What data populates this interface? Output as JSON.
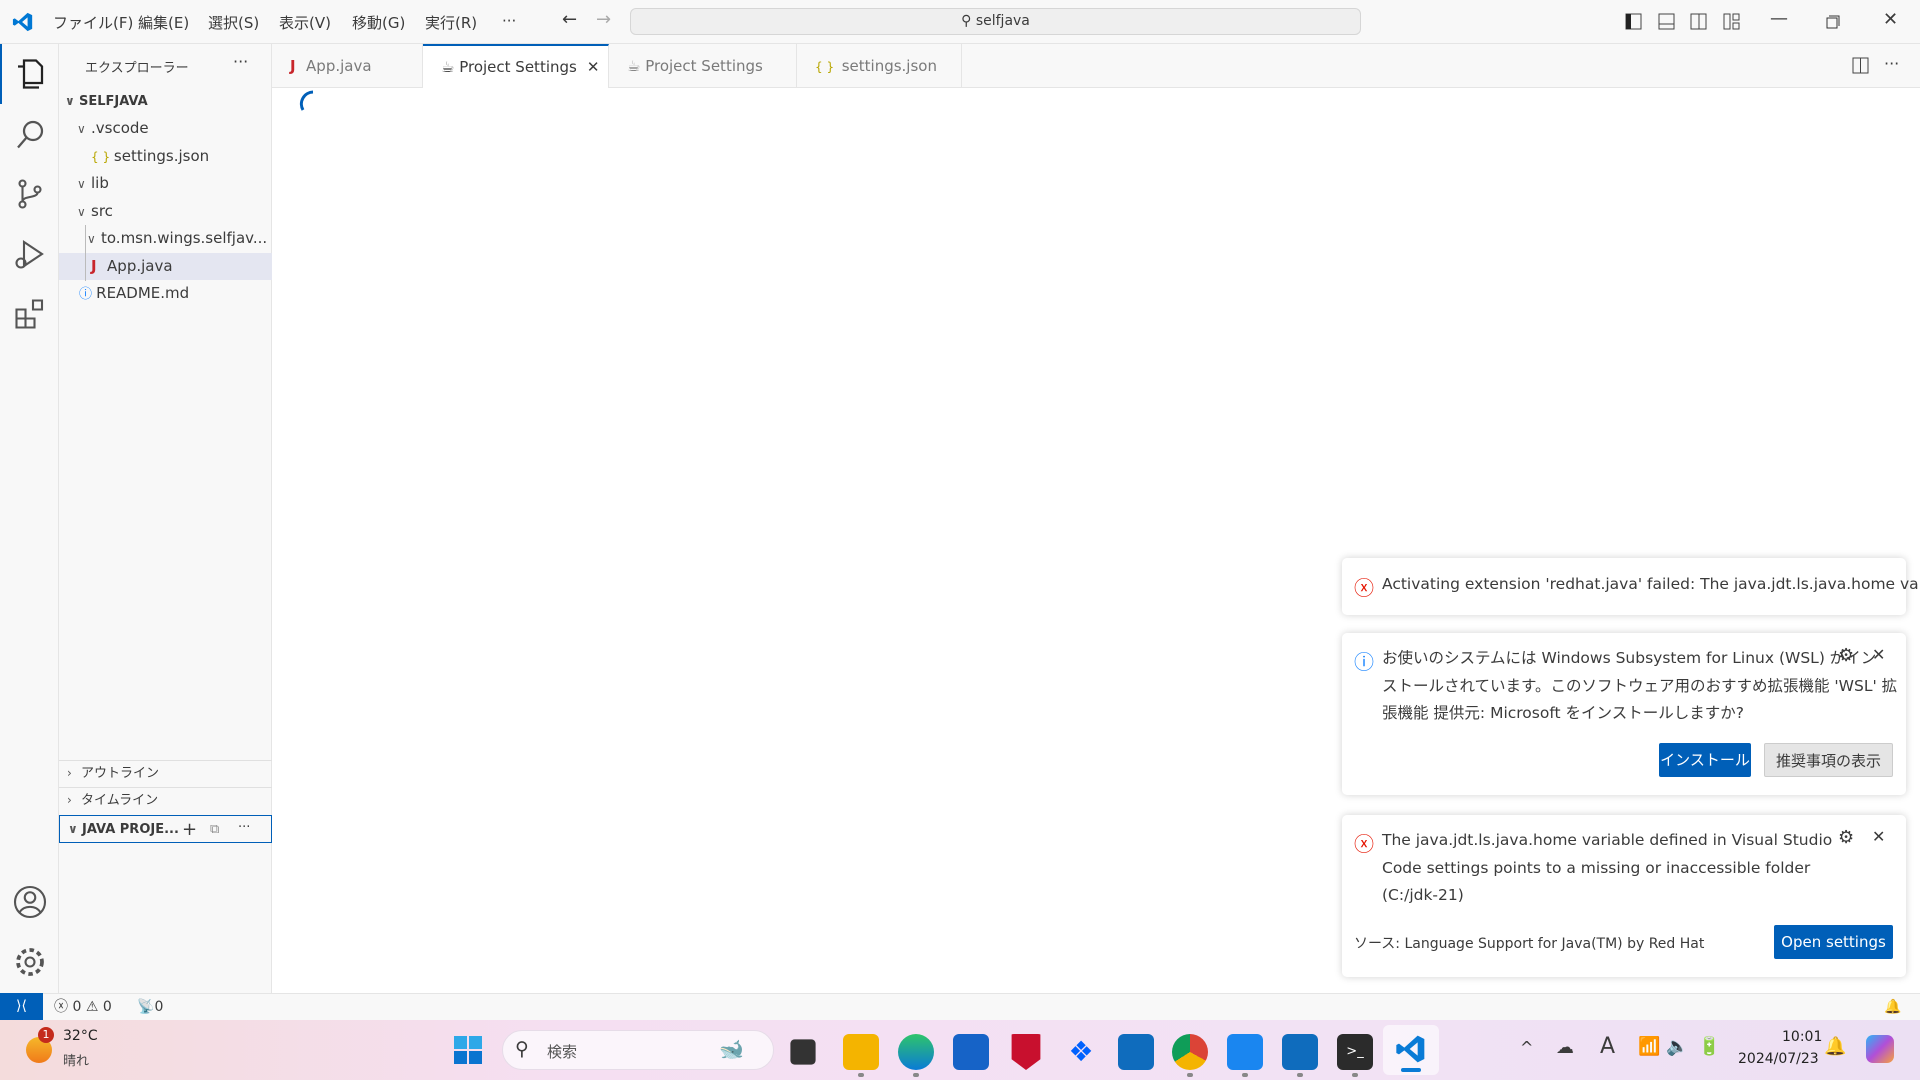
{
  "titlebar": {
    "menus": [
      "ファイル(F)",
      "編集(E)",
      "選択(S)",
      "表示(V)",
      "移動(G)",
      "実行(R)",
      "···"
    ],
    "search": "selfjava"
  },
  "sidebar": {
    "title": "エクスプローラー",
    "more": "···",
    "root": "SELFJAVA",
    "tree": [
      {
        "label": ".vscode",
        "type": "folder"
      },
      {
        "label": "settings.json",
        "type": "json"
      },
      {
        "label": "lib",
        "type": "folder"
      },
      {
        "label": "src",
        "type": "folder"
      },
      {
        "label": "to.msn.wings.selfjav...",
        "type": "folder"
      },
      {
        "label": "App.java",
        "type": "java",
        "selected": true
      },
      {
        "label": "README.md",
        "type": "info"
      }
    ],
    "sections": [
      "アウトライン",
      "タイムライン",
      "JAVA PROJE..."
    ]
  },
  "tabs": [
    {
      "label": "App.java",
      "icon": "java-icon"
    },
    {
      "label": "Project Settings",
      "icon": "cup-icon",
      "active": true
    },
    {
      "label": "Project Settings",
      "icon": "cup-icon"
    },
    {
      "label": "settings.json",
      "icon": "json-icon"
    }
  ],
  "notifications": [
    {
      "type": "error",
      "text": "Activating extension 'redhat.java' failed: The java.jdt.ls.java.home varia..."
    },
    {
      "type": "info",
      "lines": [
        "お使いのシステムには Windows Subsystem for Linux (WSL) がイン",
        "ストールされています。このソフトウェア用のおすすめ拡張機能 'WSL' 拡",
        "張機能 提供元: Microsoft をインストールしますか?"
      ],
      "buttons": [
        "インストール",
        "推奨事項の表示"
      ]
    },
    {
      "type": "error",
      "lines": [
        "The java.jdt.ls.java.home variable defined in Visual Studio",
        "Code settings points to a missing or inaccessible folder",
        "(C:/jdk-21)"
      ],
      "source": "ソース: Language Support for Java(TM) by Red Hat",
      "button": "Open settings"
    }
  ],
  "status": {
    "errors": "0",
    "warnings": "0",
    "ports": "0"
  },
  "taskbar": {
    "temp": "32°C",
    "weather": "晴れ",
    "weather_badge": "1",
    "search": "検索",
    "time": "10:01",
    "date": "2024/07/23"
  },
  "colors": {
    "accent": "#005fb8",
    "error": "#e51400",
    "info": "#1a85ff"
  }
}
